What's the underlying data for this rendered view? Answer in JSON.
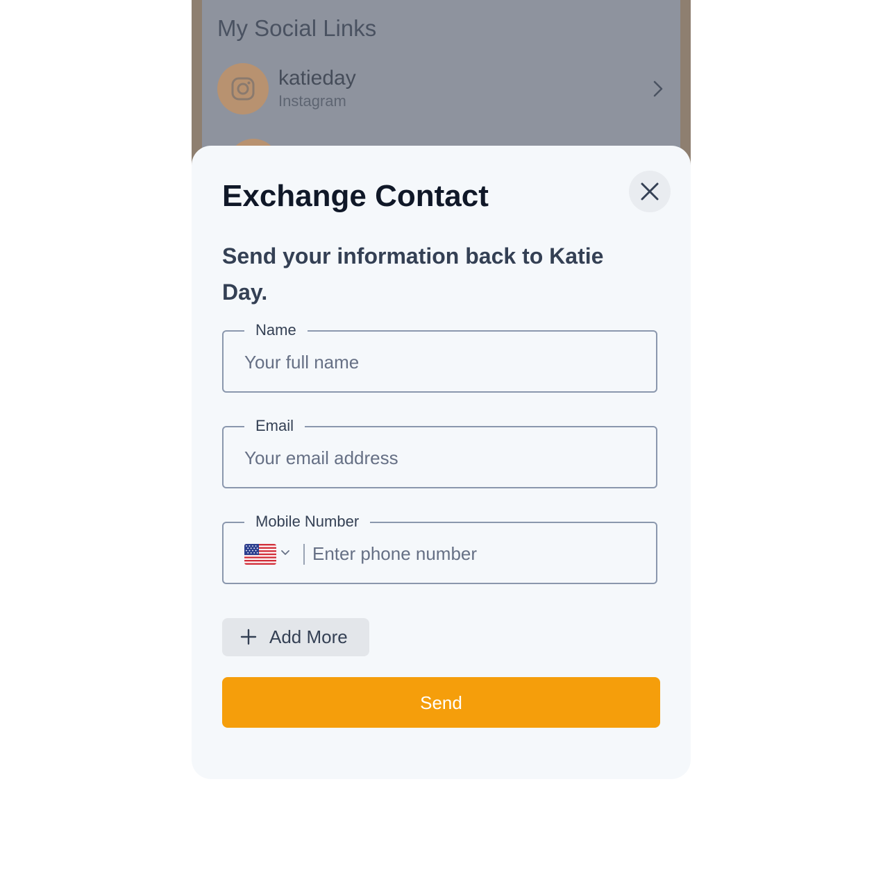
{
  "background": {
    "section_title": "My Social Links",
    "social_links": [
      {
        "username": "katieday",
        "platform": "Instagram",
        "icon": "instagram-icon"
      }
    ]
  },
  "modal": {
    "title": "Exchange Contact",
    "subtitle": "Send your information back to Katie Day.",
    "close_icon": "close-icon",
    "fields": {
      "name": {
        "label": "Name",
        "placeholder": "Your full name",
        "value": ""
      },
      "email": {
        "label": "Email",
        "placeholder": "Your email address",
        "value": ""
      },
      "mobile": {
        "label": "Mobile Number",
        "placeholder": "Enter phone number",
        "value": "",
        "country_flag": "us-flag-icon"
      }
    },
    "add_more_label": "Add More",
    "send_label": "Send"
  },
  "colors": {
    "accent": "#f59e0b",
    "title": "#101828",
    "text": "#344054",
    "overlay": "#8e939e",
    "sheet": "#f5f8fb"
  }
}
